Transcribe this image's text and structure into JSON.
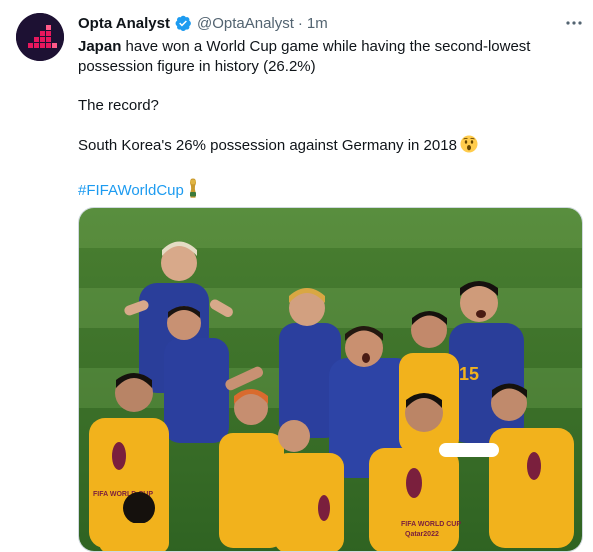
{
  "author": {
    "name": "Opta Analyst",
    "handle": "@OptaAnalyst",
    "separator": "·",
    "time": "1m",
    "avatar_icon": "opta-logo-icon",
    "verified_icon": "verified-badge-icon"
  },
  "tweet": {
    "line1_bold": "Japan",
    "line1_rest": " have won a World Cup game while having the second-lowest possession figure in history (26.2%)",
    "line2": "The record?",
    "line3": "South Korea's 26% possession against Germany in 2018",
    "line3_emoji": "astonished-face-icon",
    "hashtag": "#FIFAWorldCup",
    "hashtag_emoji": "world-cup-trophy-icon"
  },
  "media": {
    "alt_icon": "japan-team-celebration-photo",
    "jersey_number": "15",
    "bib_text_1": "FIFA WORLD CUP",
    "bib_text_2": "Qatar2022"
  },
  "colors": {
    "accent": "#1d9bf0",
    "text": "#0f1419",
    "secondary": "#536471",
    "avatar_bg": "#1d1133",
    "avatar_mark": "#e8175d",
    "pitch": "#3f7a2c",
    "jersey": "#2a3e9a",
    "bib": "#f2b21c"
  }
}
